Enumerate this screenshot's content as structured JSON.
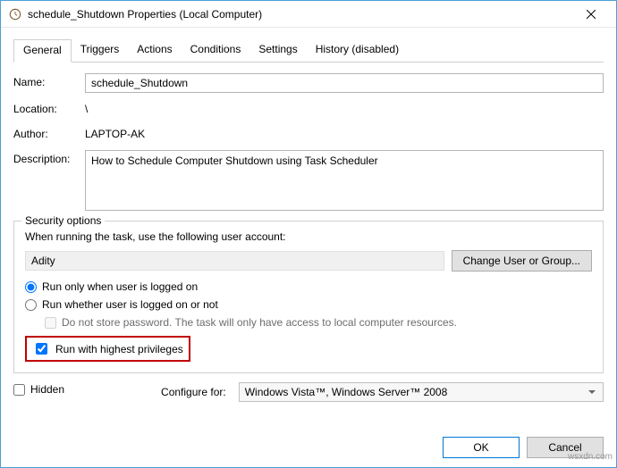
{
  "window": {
    "title": "schedule_Shutdown Properties (Local Computer)"
  },
  "tabs": [
    {
      "label": "General",
      "active": true
    },
    {
      "label": "Triggers",
      "active": false
    },
    {
      "label": "Actions",
      "active": false
    },
    {
      "label": "Conditions",
      "active": false
    },
    {
      "label": "Settings",
      "active": false
    },
    {
      "label": "History (disabled)",
      "active": false
    }
  ],
  "general": {
    "name_label": "Name:",
    "name_value": "schedule_Shutdown",
    "location_label": "Location:",
    "location_value": "\\",
    "author_label": "Author:",
    "author_value": "LAPTOP-AK",
    "description_label": "Description:",
    "description_value": "How to Schedule Computer Shutdown using Task Scheduler"
  },
  "security": {
    "fieldset_title": "Security options",
    "prompt": "When running the task, use the following user account:",
    "user": "Adity",
    "change_user_label": "Change User or Group...",
    "radio_logged_on": "Run only when user is logged on",
    "radio_whether": "Run whether user is logged on or not",
    "do_not_store": "Do not store password.  The task will only have access to local computer resources.",
    "run_highest": "Run with highest privileges",
    "radio_selected": "logged_on",
    "do_not_store_checked": false,
    "do_not_store_disabled": true,
    "run_highest_checked": true
  },
  "bottom": {
    "hidden_label": "Hidden",
    "hidden_checked": false,
    "configure_for_label": "Configure for:",
    "configure_for_value": "Windows Vista™, Windows Server™ 2008"
  },
  "footer": {
    "ok": "OK",
    "cancel": "Cancel"
  },
  "watermark": "wsxdn.com"
}
